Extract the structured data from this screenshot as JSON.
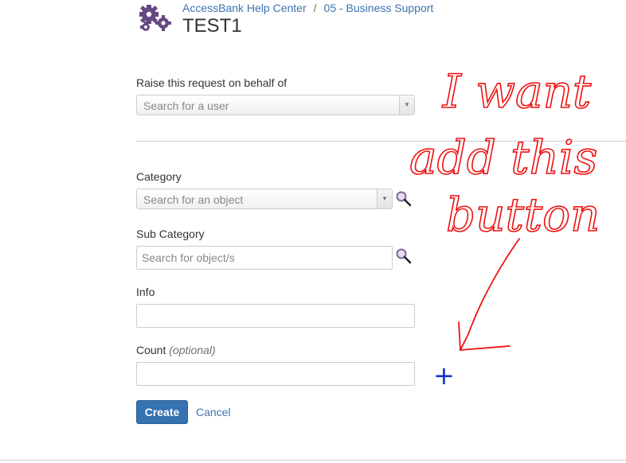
{
  "header": {
    "breadcrumb": [
      "AccessBank Help Center",
      "05 - Business Support"
    ],
    "breadcrumb_separator": "/",
    "title": "TEST1",
    "logo_icon": "gears-icon"
  },
  "form": {
    "behalf": {
      "label": "Raise this request on behalf of",
      "placeholder": "Search for a user"
    },
    "category": {
      "label": "Category",
      "placeholder": "Search for an object"
    },
    "subcategory": {
      "label": "Sub Category",
      "placeholder": "Search for object/s"
    },
    "info": {
      "label": "Info",
      "value": ""
    },
    "count": {
      "label": "Count",
      "optional": "(optional)",
      "value": ""
    }
  },
  "actions": {
    "create_label": "Create",
    "cancel_label": "Cancel"
  },
  "annotation": {
    "lines": [
      "I want",
      "add this",
      "button"
    ],
    "add_marker": "+",
    "ink_color": "#ee1111",
    "marker_color": "#1133cc"
  },
  "colors": {
    "accent": "#3572b0",
    "link": "#3b73af",
    "logo": "#654982"
  }
}
